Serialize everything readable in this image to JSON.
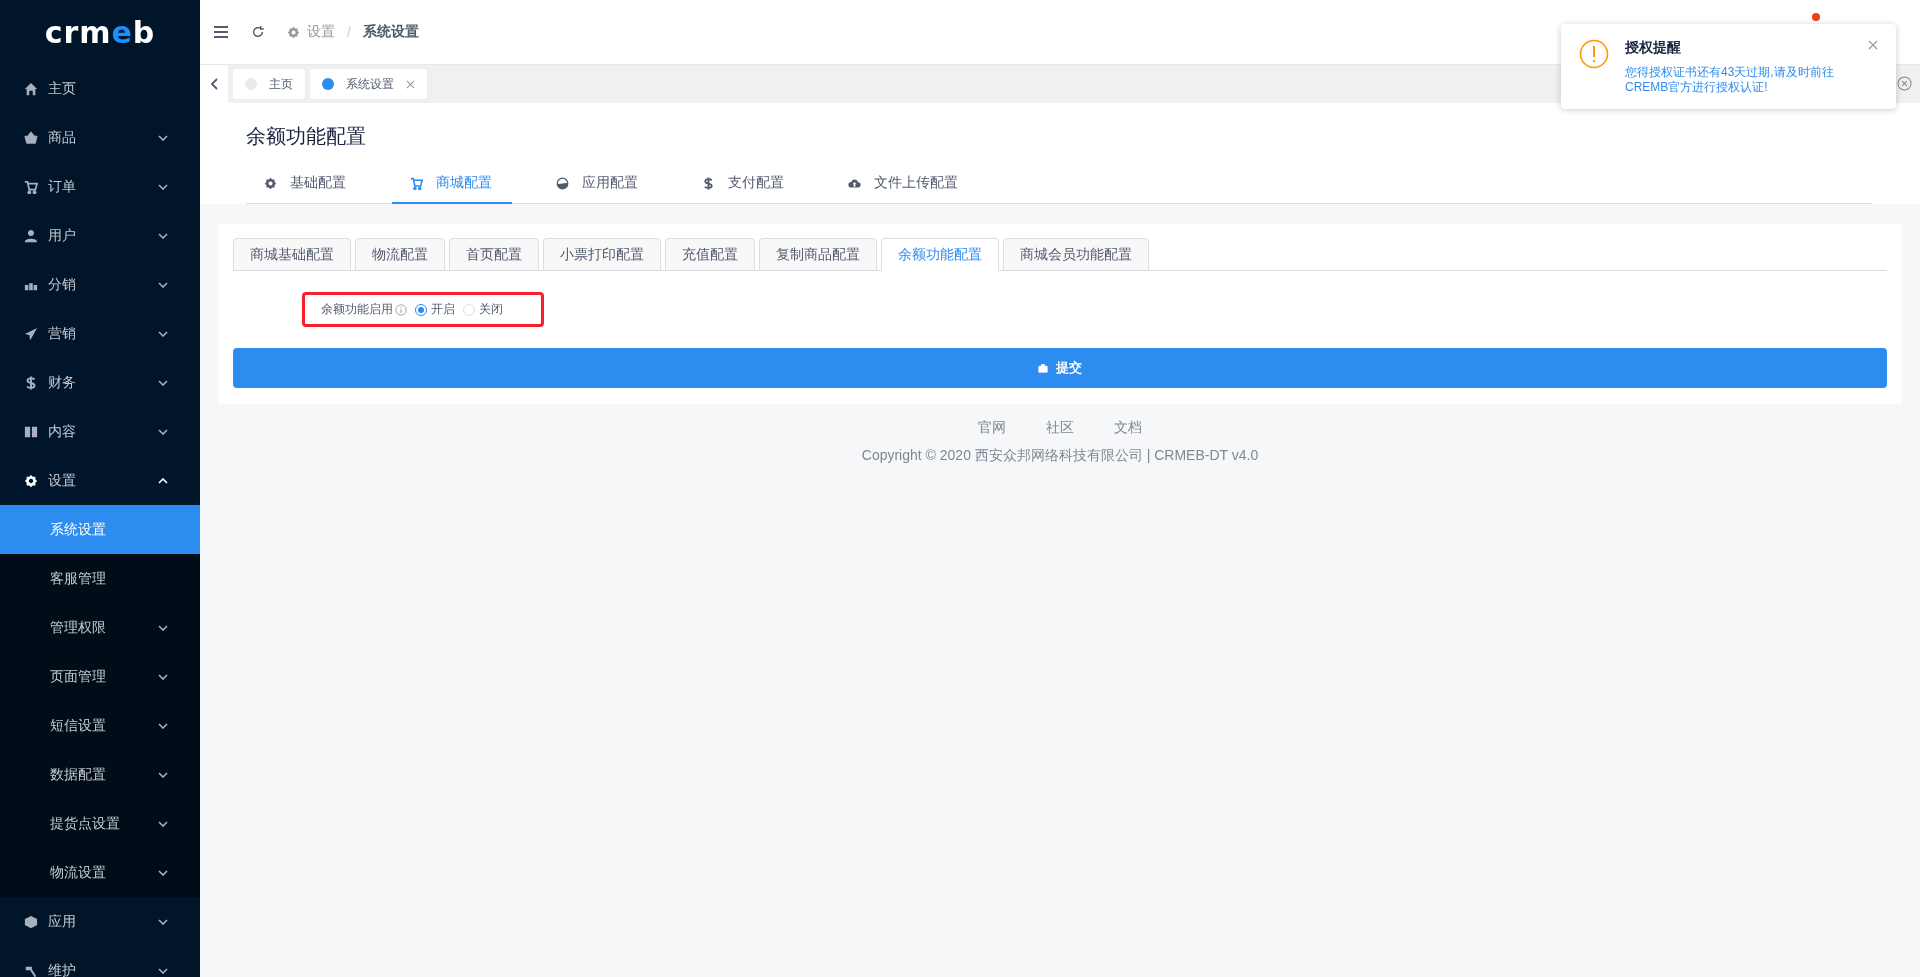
{
  "sidebar": {
    "logo": {
      "parts": [
        "crm",
        "e",
        "b"
      ]
    },
    "items": [
      {
        "label": "主页",
        "kind": "link",
        "selected": false
      },
      {
        "label": "商品",
        "kind": "menu",
        "expanded": false,
        "selected": false
      },
      {
        "label": "订单",
        "kind": "menu",
        "expanded": false,
        "selected": false
      },
      {
        "label": "用户",
        "kind": "menu",
        "expanded": false,
        "selected": false
      },
      {
        "label": "分销",
        "kind": "menu",
        "expanded": false,
        "selected": false
      },
      {
        "label": "营销",
        "kind": "menu",
        "expanded": false,
        "selected": false
      },
      {
        "label": "财务",
        "kind": "menu",
        "expanded": false,
        "selected": false
      },
      {
        "label": "内容",
        "kind": "menu",
        "expanded": false,
        "selected": false
      },
      {
        "label": "设置",
        "kind": "menu",
        "expanded": true,
        "selected": false,
        "children": [
          {
            "label": "系统设置",
            "kind": "link",
            "selected": true
          },
          {
            "label": "客服管理",
            "kind": "link",
            "selected": false
          },
          {
            "label": "管理权限",
            "kind": "menu",
            "expanded": false,
            "selected": false
          },
          {
            "label": "页面管理",
            "kind": "menu",
            "expanded": false,
            "selected": false
          },
          {
            "label": "短信设置",
            "kind": "menu",
            "expanded": false,
            "selected": false
          },
          {
            "label": "数据配置",
            "kind": "menu",
            "expanded": false,
            "selected": false
          },
          {
            "label": "提货点设置",
            "kind": "menu",
            "expanded": false,
            "selected": false
          },
          {
            "label": "物流设置",
            "kind": "menu",
            "expanded": false,
            "selected": false
          }
        ]
      },
      {
        "label": "应用",
        "kind": "menu",
        "expanded": false,
        "selected": false
      },
      {
        "label": "维护",
        "kind": "menu",
        "expanded": false,
        "selected": false
      }
    ]
  },
  "header": {
    "breadcrumb": [
      "设置",
      "系统设置"
    ],
    "separator": "/",
    "notification_dot": true
  },
  "tag_bar": {
    "tags": [
      {
        "label": "主页",
        "selected": false,
        "closable": false
      },
      {
        "label": "系统设置",
        "selected": true,
        "closable": true
      }
    ]
  },
  "page": {
    "title": "余额功能配置",
    "tabs": [
      {
        "label": "基础配置",
        "selected": false
      },
      {
        "label": "商城配置",
        "selected": true
      },
      {
        "label": "应用配置",
        "selected": false
      },
      {
        "label": "支付配置",
        "selected": false
      },
      {
        "label": "文件上传配置",
        "selected": false
      }
    ]
  },
  "card": {
    "tabs": [
      {
        "label": "商城基础配置",
        "selected": false
      },
      {
        "label": "物流配置",
        "selected": false
      },
      {
        "label": "首页配置",
        "selected": false
      },
      {
        "label": "小票打印配置",
        "selected": false
      },
      {
        "label": "充值配置",
        "selected": false
      },
      {
        "label": "复制商品配置",
        "selected": false
      },
      {
        "label": "余额功能配置",
        "selected": true
      },
      {
        "label": "商城会员功能配置",
        "selected": false
      }
    ],
    "field": {
      "label": "余额功能启用",
      "highlighted": true,
      "options": [
        {
          "label": "开启",
          "selected": true
        },
        {
          "label": "关闭",
          "selected": false
        }
      ]
    },
    "submit": "提交"
  },
  "footer": {
    "links": [
      "官网",
      "社区",
      "文档"
    ],
    "copyright": "Copyright © 2020 西安众邦网络科技有限公司 | CRMEB-DT v4.0"
  },
  "notification": {
    "title": "授权提醒",
    "message": "您得授权证书还有43天过期,请及时前往CREMB官方进行授权认证!"
  }
}
